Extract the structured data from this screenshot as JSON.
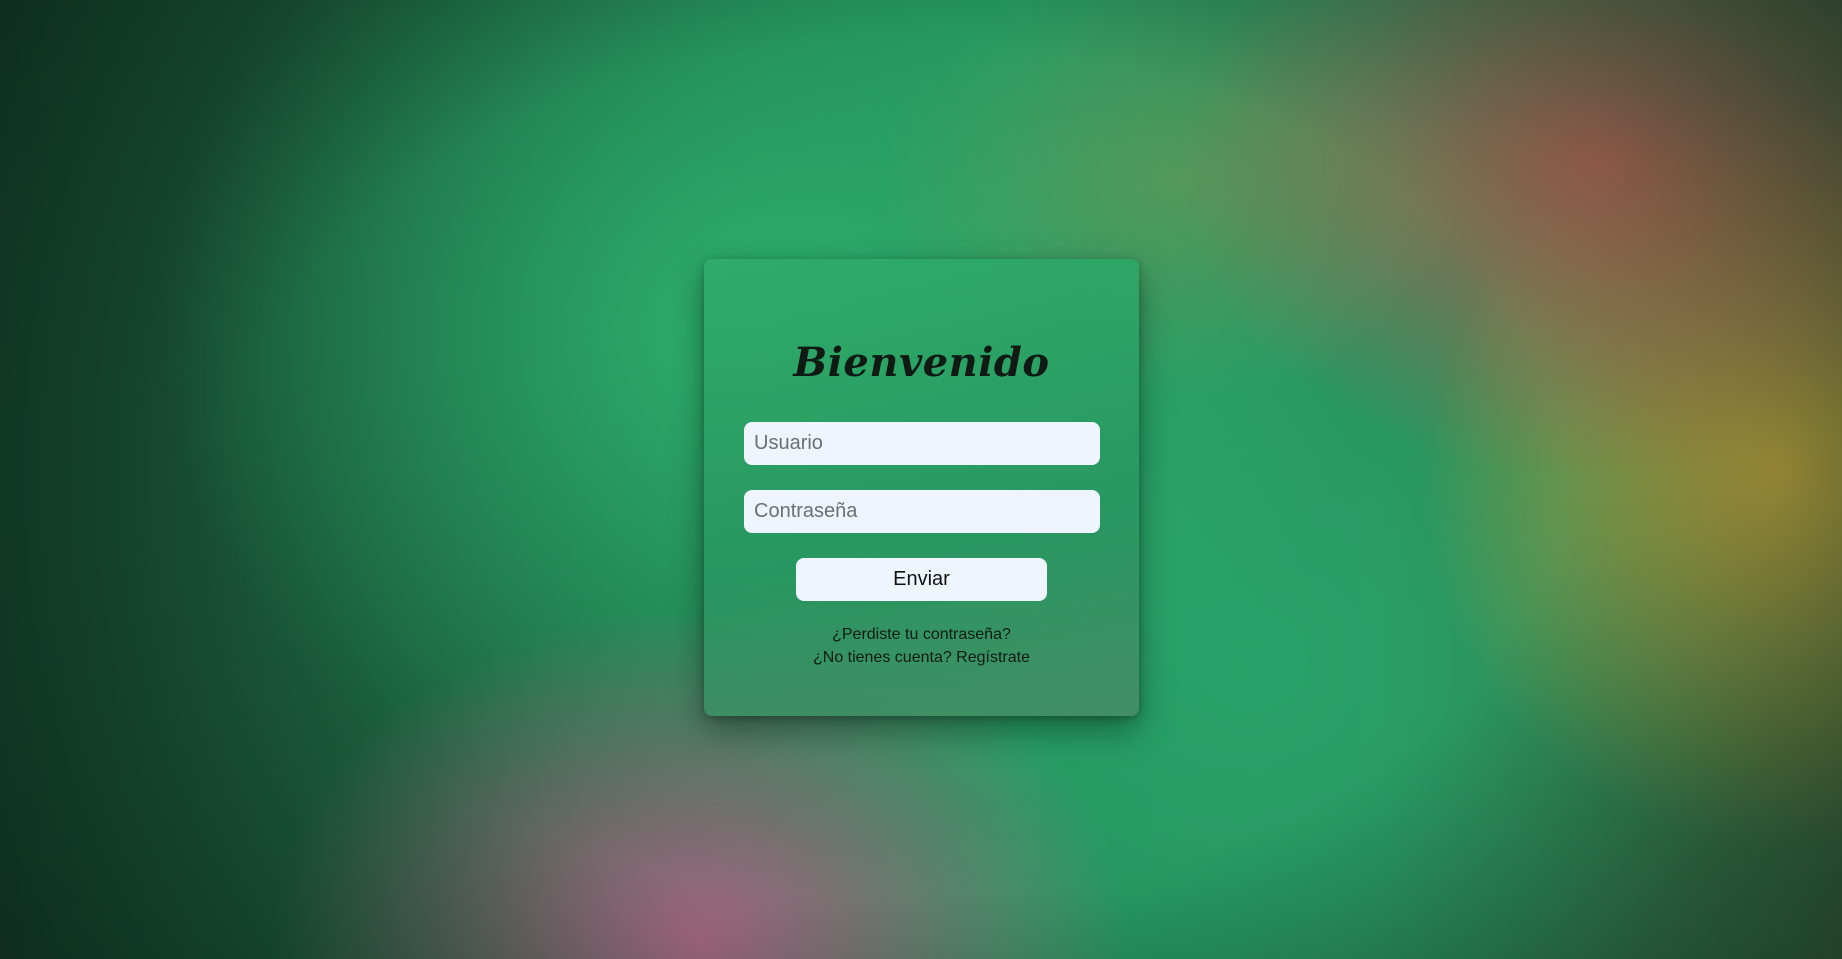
{
  "login": {
    "title": "Bienvenido",
    "username_placeholder": "Usuario",
    "username_value": "",
    "password_placeholder": "Contraseña",
    "password_value": "",
    "submit_label": "Enviar",
    "forgot_password_link": "¿Perdiste tu contraseña?",
    "register_link": "¿No tienes cuenta? Regístrate"
  },
  "colors": {
    "card": "#2eac68",
    "input_background": "#eef5fd",
    "text": "#0f1a14"
  }
}
